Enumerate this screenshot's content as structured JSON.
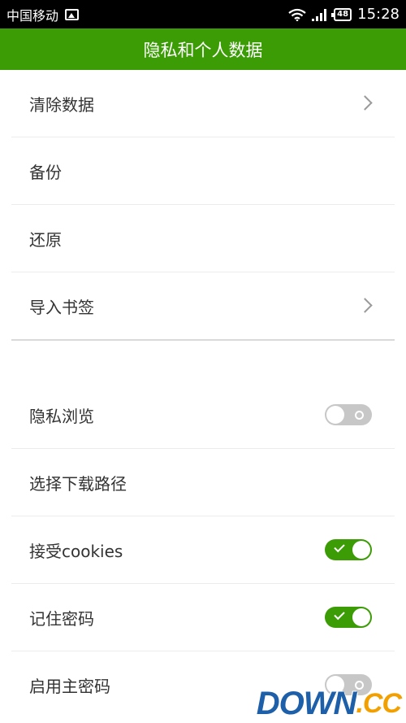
{
  "statusbar": {
    "carrier": "中国移动",
    "battery": "48",
    "time": "15:28"
  },
  "header": {
    "title": "隐私和个人数据"
  },
  "section1": [
    {
      "label": "清除数据",
      "has_chevron": true
    },
    {
      "label": "备份",
      "has_chevron": false
    },
    {
      "label": "还原",
      "has_chevron": false
    },
    {
      "label": "导入书签",
      "has_chevron": true
    }
  ],
  "section2": [
    {
      "label": "隐私浏览",
      "toggle": "off"
    },
    {
      "label": "选择下载路径"
    },
    {
      "label": "接受cookies",
      "toggle": "on"
    },
    {
      "label": "记住密码",
      "toggle": "on"
    },
    {
      "label": "启用主密码",
      "toggle": "off"
    }
  ],
  "watermark": {
    "main": "DOWN",
    "suffix": ".CC"
  },
  "colors": {
    "accent": "#3c9c06",
    "statusbar": "#000000",
    "toggle_off": "#c7c7c7"
  }
}
